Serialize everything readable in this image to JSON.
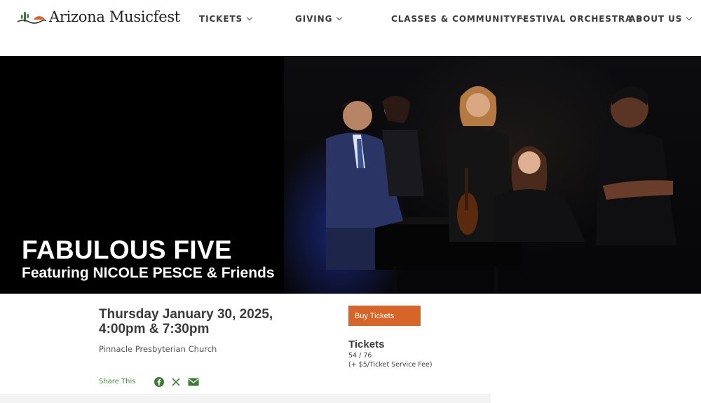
{
  "logo": {
    "text": "Arizona Musicfest"
  },
  "nav": [
    {
      "label": "TICKETS"
    },
    {
      "label": "GIVING"
    },
    {
      "label": "CLASSES & COMMUNITY"
    },
    {
      "label": "FESTIVAL ORCHESTRA"
    },
    {
      "label": "ABOUT US"
    }
  ],
  "hero": {
    "title": "FABULOUS FIVE",
    "subtitle": "Featuring NICOLE PESCE & Friends"
  },
  "event": {
    "date_line1": "Thursday January 30, 2025,",
    "date_line2": "4:00pm & 7:30pm",
    "venue": "Pinnacle Presbyterian Church"
  },
  "share": {
    "label": "Share This",
    "icons": [
      "facebook-icon",
      "x-icon",
      "email-icon"
    ]
  },
  "tickets": {
    "buy_label": "Buy Tickets",
    "heading": "Tickets",
    "price": "54 / 76",
    "fee": "(+ $5/Ticket Service Fee)"
  },
  "colors": {
    "accent": "#d6652a",
    "share_green": "#4a8a3f",
    "hero_bg": "#000000"
  }
}
